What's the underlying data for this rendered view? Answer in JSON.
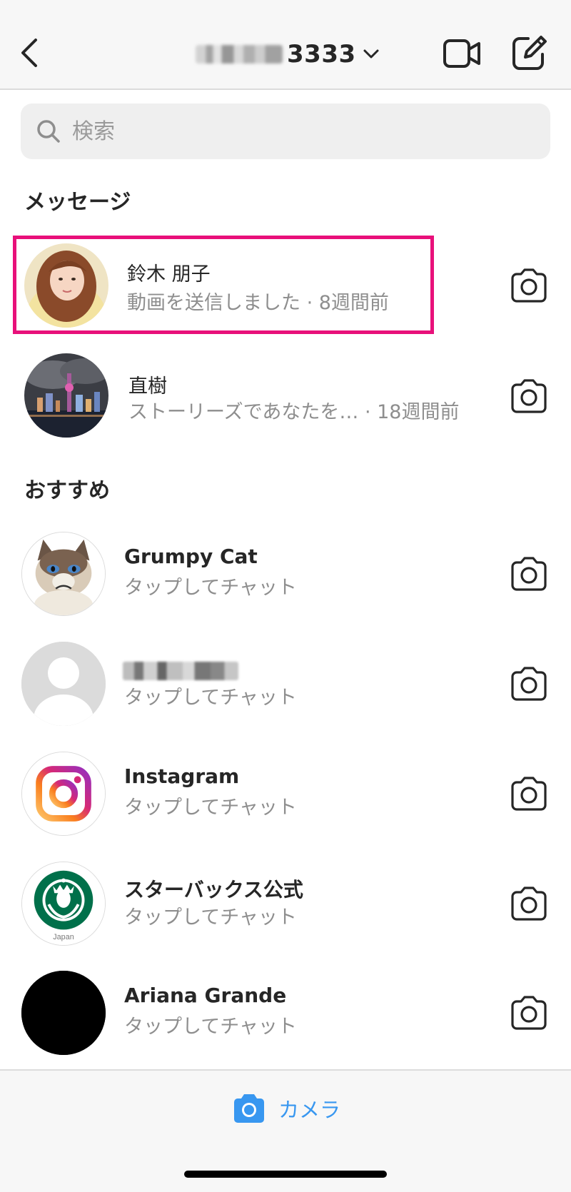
{
  "header": {
    "title_suffix": "3333",
    "back_icon": "chevron-left-icon",
    "video_icon": "video-camera-icon",
    "compose_icon": "compose-icon",
    "dropdown_icon": "chevron-down-icon"
  },
  "search": {
    "placeholder": "検索",
    "icon": "search-icon"
  },
  "sections": {
    "messages": "メッセージ",
    "suggested": "おすすめ"
  },
  "messages": [
    {
      "name": "鈴木 朋子",
      "subtitle": "動画を送信しました · 8週間前",
      "highlighted": true
    },
    {
      "name": "直樹",
      "subtitle": "ストーリーズであなたを… · 18週間前"
    }
  ],
  "suggested": [
    {
      "name": "Grumpy Cat",
      "subtitle": "タップしてチャット"
    },
    {
      "name": "",
      "subtitle": "タップしてチャット",
      "name_blurred": true
    },
    {
      "name": "Instagram",
      "subtitle": "タップしてチャット"
    },
    {
      "name": "スターバックス公式",
      "subtitle": "タップしてチャット",
      "avatar_text": "Japan"
    },
    {
      "name": "Ariana Grande",
      "subtitle": "タップしてチャット"
    }
  ],
  "bottom": {
    "camera_label": "カメラ",
    "camera_icon": "camera-icon"
  },
  "colors": {
    "highlight": "#e8107a",
    "accent": "#3897f0",
    "secondary_text": "#8e8e8e"
  }
}
